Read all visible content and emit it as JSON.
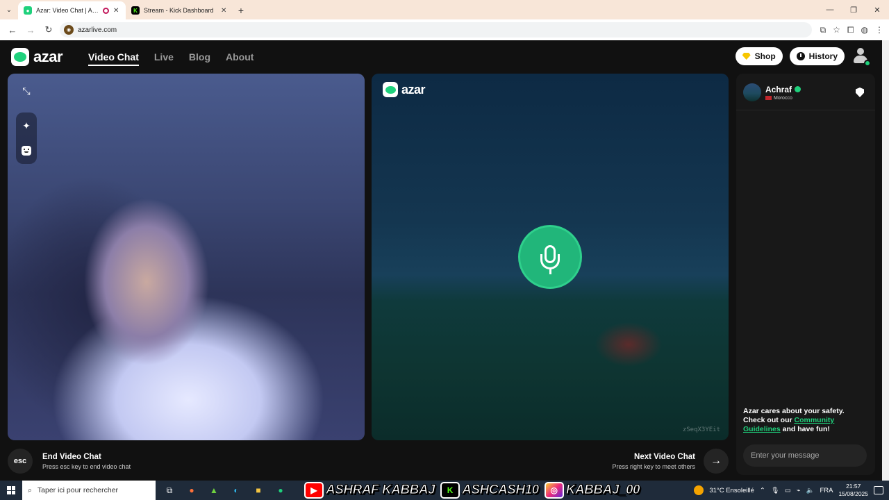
{
  "browser": {
    "tabs": [
      {
        "title": "Azar: Video Chat | Alternativ",
        "favicon": "azar-icon",
        "active": true
      },
      {
        "title": "Stream - Kick Dashboard",
        "favicon": "kick-icon",
        "active": false
      }
    ],
    "url": "azarlive.com"
  },
  "app": {
    "logo_text": "azar",
    "nav": [
      {
        "label": "Video Chat",
        "active": true
      },
      {
        "label": "Live",
        "active": false
      },
      {
        "label": "Blog",
        "active": false
      },
      {
        "label": "About",
        "active": false
      }
    ],
    "shop_label": "Shop",
    "history_label": "History",
    "accent_color": "#1fd17c"
  },
  "video": {
    "remote_logo": "azar",
    "session_id": "zSeqX3YEit"
  },
  "peer": {
    "name": "Achraf",
    "country": "Morocco"
  },
  "chat": {
    "safety_line1": "Azar cares about your safety.",
    "safety_line2": "Check out our",
    "safety_link": "Community Guidelines",
    "safety_line3": "and have fun!",
    "input_placeholder": "Enter your message"
  },
  "controls": {
    "end_key": "esc",
    "end_title": "End Video Chat",
    "end_sub": "Press esc key to end video chat",
    "next_title": "Next Video Chat",
    "next_sub": "Press right key to meet others"
  },
  "taskbar": {
    "search_placeholder": "Taper ici pour rechercher",
    "handles": [
      {
        "platform": "youtube",
        "icon_text": "▶",
        "text": "ASHRAF KABBAJ"
      },
      {
        "platform": "kick",
        "icon_text": "K",
        "text": "ASHCASH10"
      },
      {
        "platform": "instagram",
        "icon_text": "◎",
        "text": "KABBAJ_00"
      }
    ],
    "weather": "31°C  Ensoleillé",
    "lang": "FRA",
    "time": "21:57",
    "date": "15/08/2025"
  }
}
